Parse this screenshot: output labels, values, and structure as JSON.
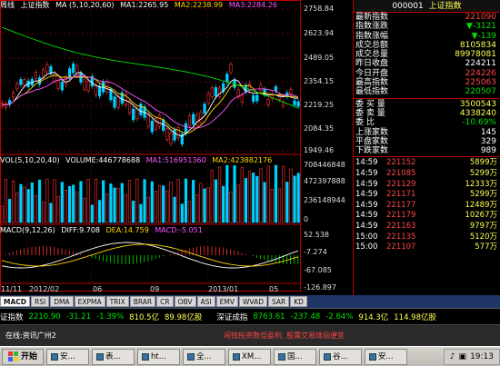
{
  "chart": {
    "period_label": "周线",
    "index_name": "上证指数",
    "ma_header": "MA (5,10,20,60)",
    "ma_values": [
      {
        "label": "MA1:",
        "value": "2265.95",
        "color": "#ffffff"
      },
      {
        "label": "MA2:",
        "value": "2238.99",
        "color": "#ffd700"
      },
      {
        "label": "MA3:",
        "value": "2284.26",
        "color": "#ff55ff"
      }
    ],
    "price_axis": [
      "2758.84",
      "2623.94",
      "2489.05",
      "2354.15",
      "2219.25",
      "2084.35",
      "1949.46"
    ],
    "vol_header": "VOL(5,10,20,40)",
    "vol_values": [
      {
        "label": "VOLUME:",
        "value": "446778688",
        "color": "#ffffff"
      },
      {
        "label": "MA1:",
        "value": "516951360",
        "color": "#ff55ff"
      },
      {
        "label": "MA2:",
        "value": "423882176",
        "color": "#ffd700"
      }
    ],
    "vol_axis": [
      "708446848",
      "472397888",
      "236148944",
      "0"
    ],
    "macd_header": "MACD(9,12,26)",
    "macd_values": [
      {
        "label": "DIFF:",
        "value": "9.708",
        "color": "#ffffff"
      },
      {
        "label": "DEA:",
        "value": "14.759",
        "color": "#ffd700"
      },
      {
        "label": "MACD:",
        "value": "-5.051",
        "color": "#ff55ff"
      }
    ],
    "macd_axis": [
      "52.538",
      "-7.274",
      "-67.085",
      "-126.897"
    ],
    "date_axis": [
      "11/11",
      "2012/02",
      "06",
      "09",
      "2013/01",
      "05"
    ]
  },
  "quote": {
    "code": "000001",
    "name": "上证指数",
    "rows1": [
      {
        "label": "最新指数",
        "value": "221090",
        "color": "#ff4444"
      },
      {
        "label": "指数涨跌",
        "value": "▼-3121",
        "color": "#00e000"
      },
      {
        "label": "指数涨幅",
        "value": "▼-139",
        "color": "#00e000"
      },
      {
        "label": "成交总额",
        "value": "8105834",
        "color": "#ffff55"
      },
      {
        "label": "成交总量",
        "value": "89978081",
        "color": "#ffff55"
      },
      {
        "label": "昨日收盘",
        "value": "224211",
        "color": "#ffffff"
      },
      {
        "label": "今日开盘",
        "value": "224226",
        "color": "#ff4444"
      },
      {
        "label": "最高指数",
        "value": "225063",
        "color": "#ff4444"
      },
      {
        "label": "最低指数",
        "value": "220507",
        "color": "#00e000"
      }
    ],
    "rows2": [
      {
        "label": "委 买 量",
        "value": "3500543",
        "color": "#ffff55"
      },
      {
        "label": "委 卖 量",
        "value": "4338240",
        "color": "#ffff55"
      },
      {
        "label": "委  比",
        "value": "-10.69%",
        "color": "#00e000"
      },
      {
        "label": "上涨家数",
        "value": "145",
        "color": "#ffffff"
      },
      {
        "label": "平盘家数",
        "value": "329",
        "color": "#ffffff"
      },
      {
        "label": "下跌家数",
        "value": "989",
        "color": "#ffffff"
      }
    ],
    "trades": [
      {
        "time": "14:59",
        "price": "221152",
        "dir": "",
        "vol": "5899万"
      },
      {
        "time": "14:59",
        "price": "221085",
        "dir": "",
        "vol": "5299万"
      },
      {
        "time": "14:59",
        "price": "221129",
        "dir": "",
        "vol": "12333万"
      },
      {
        "time": "14:59",
        "price": "221171",
        "dir": "",
        "vol": "5299万"
      },
      {
        "time": "14:59",
        "price": "221177",
        "dir": "",
        "vol": "12489万"
      },
      {
        "time": "14:59",
        "price": "221179",
        "dir": "",
        "vol": "10267万"
      },
      {
        "time": "14:59",
        "price": "221163",
        "dir": "",
        "vol": "9797万"
      },
      {
        "time": "15:00",
        "price": "221135",
        "dir": "",
        "vol": "5120万"
      },
      {
        "time": "15:00",
        "price": "221107",
        "dir": "",
        "vol": "577万"
      }
    ]
  },
  "tabs": [
    "MACD",
    "RSI",
    "DMA",
    "EXPMA",
    "TRIX",
    "BRAR",
    "CR",
    "OBV",
    "ASI",
    "EMV",
    "WVAD",
    "SAR",
    "KD"
  ],
  "ticker": {
    "label1": "证指数",
    "value1": "2210.90",
    "change1": "-31.21",
    "pct1": "-1.39%",
    "amount1": "810.5亿",
    "vol1": "89.98亿股",
    "label2": "深证成指",
    "value2": "8763.61",
    "change2": "-237.48",
    "pct2": "-2.64%",
    "amount2": "914.3亿",
    "vol2": "114.98亿股"
  },
  "status": {
    "left": "在线:资讯广州2",
    "center": "闲钱投资数倍盈利, 股票交易体验便宜"
  },
  "taskbar": {
    "start": "开始",
    "tasks": [
      "安...",
      "表...",
      "ht...",
      "全...",
      "XM...",
      "国...",
      "谷...",
      "安..."
    ],
    "clock": "19:13"
  }
}
